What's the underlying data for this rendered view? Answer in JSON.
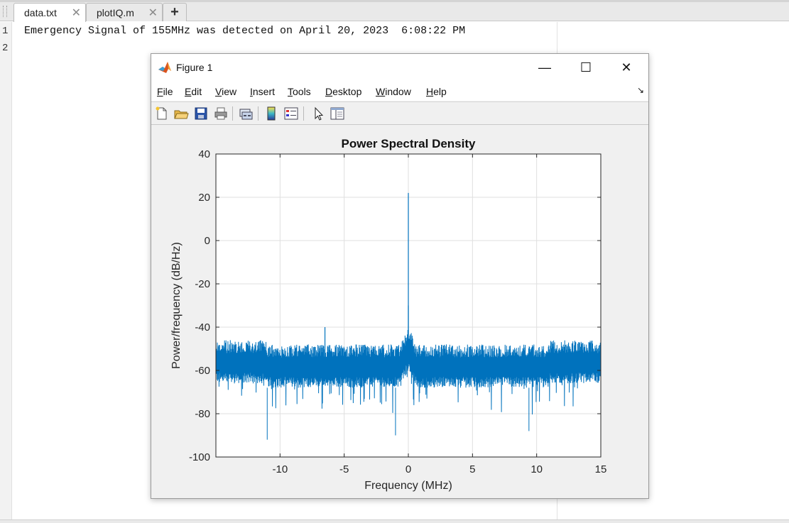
{
  "editor": {
    "tabs": [
      {
        "label": "data.txt",
        "active": true
      },
      {
        "label": "plotIQ.m",
        "active": false
      }
    ],
    "add_tab_symbol": "+",
    "close_symbol": "✕",
    "lines": [
      {
        "number": "1",
        "text": "Emergency Signal of 155MHz was detected on April 20, 2023  6:08:22 PM"
      },
      {
        "number": "2",
        "text": ""
      }
    ]
  },
  "figure_window": {
    "title": "Figure 1",
    "controls": {
      "minimize": "—",
      "maximize": "☐",
      "close": "✕"
    },
    "menu": [
      {
        "label": "File",
        "accel": "F",
        "rest": "ile"
      },
      {
        "label": "Edit",
        "accel": "E",
        "rest": "dit"
      },
      {
        "label": "View",
        "accel": "V",
        "rest": "iew"
      },
      {
        "label": "Insert",
        "accel": "I",
        "rest": "nsert"
      },
      {
        "label": "Tools",
        "accel": "T",
        "rest": "ools"
      },
      {
        "label": "Desktop",
        "accel": "D",
        "rest": "esktop"
      },
      {
        "label": "Window",
        "accel": "W",
        "rest": "indow"
      },
      {
        "label": "Help",
        "accel": "H",
        "rest": "elp"
      }
    ],
    "menu_overflow_symbol": "↘",
    "toolbar_icons": [
      "new-figure-icon",
      "open-folder-icon",
      "save-icon",
      "print-icon",
      "link-plot-icon",
      "colorbar-icon",
      "legend-icon",
      "pointer-icon",
      "property-inspector-icon"
    ]
  },
  "chart_data": {
    "type": "line",
    "title": "Power Spectral Density",
    "xlabel": "Frequency (MHz)",
    "ylabel": "Power/frequency (dB/Hz)",
    "xlim": [
      -15,
      15
    ],
    "ylim": [
      -100,
      40
    ],
    "xticks": [
      -10,
      -5,
      0,
      5,
      10,
      15
    ],
    "yticks": [
      40,
      20,
      0,
      -20,
      -40,
      -60,
      -80,
      -100
    ],
    "grid": true,
    "series": [
      {
        "color": "#0072BD",
        "noise_floor_center_db": -57,
        "noise_floor_upper_db": -48,
        "noise_floor_lower_db": -68,
        "peaks": [
          {
            "x": 0,
            "y": 22
          },
          {
            "x": 0,
            "y": -30
          },
          {
            "x": -6.5,
            "y": -40
          }
        ],
        "deep_dips": [
          {
            "x": -11,
            "y": -92
          },
          {
            "x": -1,
            "y": -90
          },
          {
            "x": 9.4,
            "y": -88
          }
        ]
      }
    ]
  }
}
